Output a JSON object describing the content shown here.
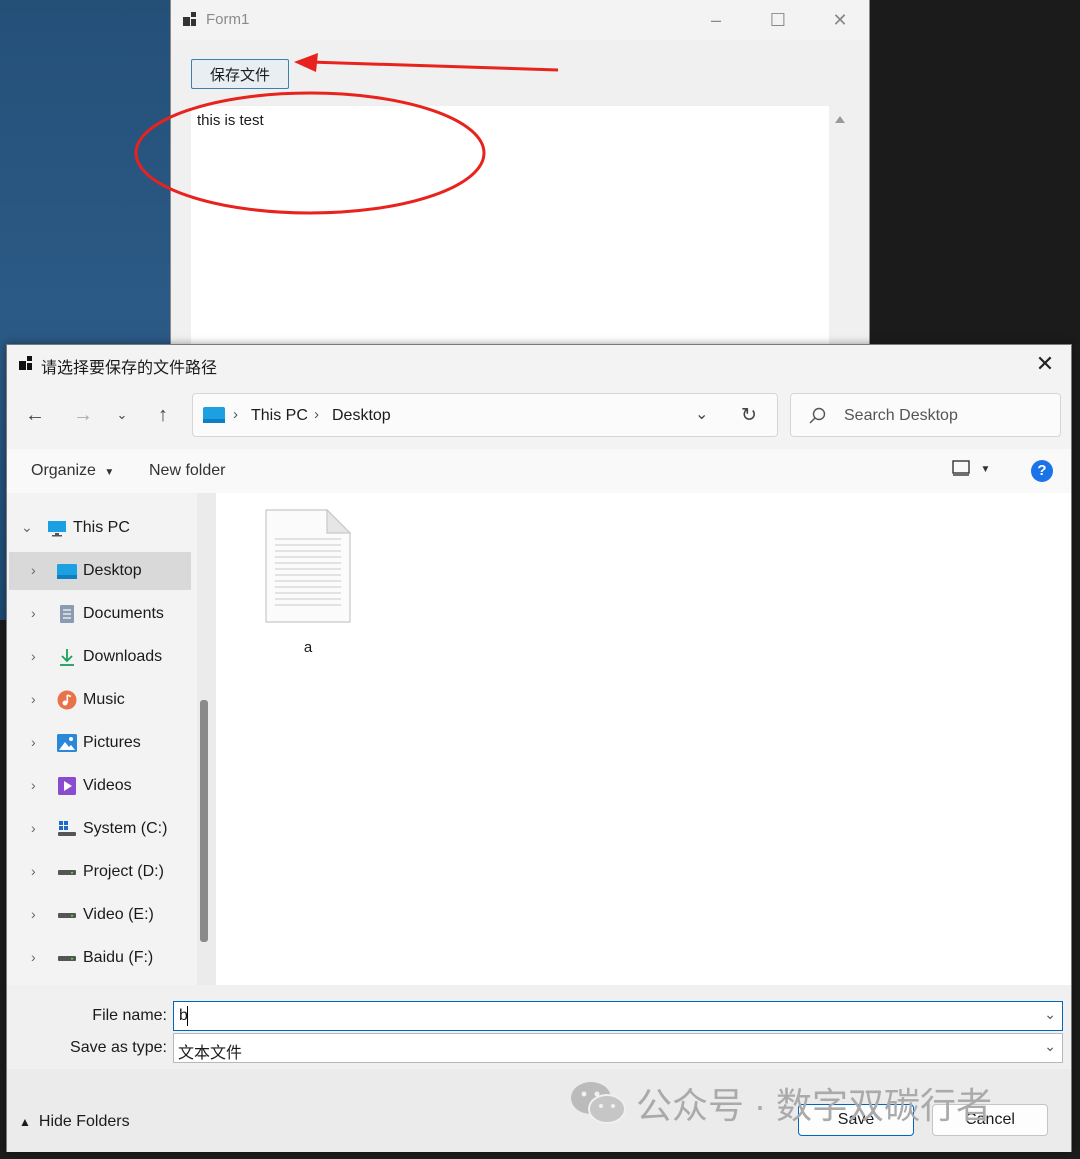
{
  "form1": {
    "title": "Form1",
    "save_file_button": "保存文件",
    "textbox_text": "this is test"
  },
  "dialog": {
    "title": "请选择要保存的文件路径",
    "breadcrumb": [
      "This PC",
      "Desktop"
    ],
    "search_placeholder": "Search Desktop",
    "toolbar": {
      "organize": "Organize",
      "new_folder": "New folder"
    },
    "nav_items": [
      {
        "label": "This PC",
        "icon": "monitor-icon"
      },
      {
        "label": "Desktop",
        "icon": "desktop-folder-icon"
      },
      {
        "label": "Documents",
        "icon": "documents-icon"
      },
      {
        "label": "Downloads",
        "icon": "download-icon"
      },
      {
        "label": "Music",
        "icon": "music-icon"
      },
      {
        "label": "Pictures",
        "icon": "pictures-icon"
      },
      {
        "label": "Videos",
        "icon": "videos-icon"
      },
      {
        "label": "System (C:)",
        "icon": "system-drive-icon"
      },
      {
        "label": "Project (D:)",
        "icon": "drive-icon"
      },
      {
        "label": "Video (E:)",
        "icon": "drive-icon"
      },
      {
        "label": "Baidu (F:)",
        "icon": "drive-icon"
      }
    ],
    "files": [
      {
        "name": "a",
        "icon": "text-file-icon"
      }
    ],
    "file_name_label": "File name:",
    "file_name_value": "b",
    "save_as_type_label": "Save as type:",
    "save_as_type_value": "文本文件",
    "hide_folders": "Hide Folders",
    "save_button": "Save",
    "cancel_button": "Cancel"
  },
  "watermark": {
    "text": "公众号 · 数字双碳行者"
  },
  "colors": {
    "accent": "#0067c0",
    "annotation": "#e8221c",
    "desktop": "#245078"
  }
}
